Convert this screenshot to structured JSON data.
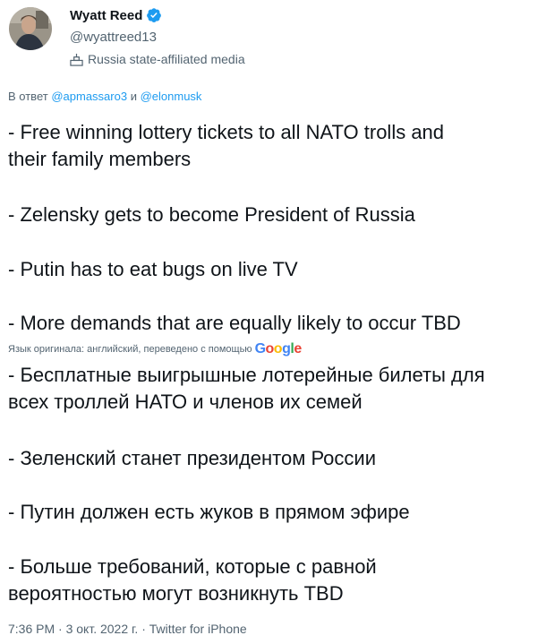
{
  "author": {
    "name": "Wyatt Reed",
    "handle": "@wyattreed13",
    "label": "Russia state-affiliated media"
  },
  "reply": {
    "prefix": "В ответ",
    "mention1": "@apmassaro3",
    "conjunction": "и",
    "mention2": "@elonmusk"
  },
  "original_text": {
    "p1_line1": "- Free winning lottery tickets to all NATO trolls and",
    "p1_line2": "their family members",
    "p2": "- Zelensky gets to become President of Russia",
    "p3": "- Putin has to eat bugs on live TV",
    "p4": "- More demands that are equally likely to occur TBD"
  },
  "translation": {
    "note": "Язык оригинала: английский, переведено с помощью",
    "brand_letters": [
      "G",
      "o",
      "o",
      "g",
      "l",
      "e"
    ],
    "brand_colors": [
      "#4285F4",
      "#EA4335",
      "#FBBC05",
      "#4285F4",
      "#34A853",
      "#EA4335"
    ],
    "p1_line1": "- Бесплатные выигрышные лотерейные билеты для",
    "p1_line2": "всех троллей НАТО и членов их семей",
    "p2": "- Зеленский станет президентом России",
    "p3": "- Путин должен есть жуков в прямом эфире",
    "p4_line1": "- Больше требований, которые с равной",
    "p4_line2": "вероятностью могут возникнуть TBD"
  },
  "meta": {
    "time": "7:36 PM",
    "sep1": " · ",
    "date": "3 окт. 2022 г.",
    "sep2": " · ",
    "source": "Twitter for iPhone"
  },
  "colors": {
    "accent": "#1d9bf0",
    "secondary_text": "#536471",
    "primary_text": "#0f1419"
  }
}
